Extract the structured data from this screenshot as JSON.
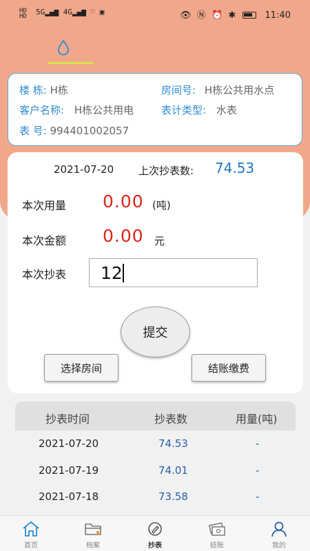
{
  "status_bar": {
    "left_top": "HD",
    "left_bottom": "HD",
    "network": "5G",
    "signal2": "4G",
    "right_icons": "👁 Ⓝ ⏰ ✱",
    "time": "11:40"
  },
  "tab_icon": "water-drop-icon",
  "info": {
    "building_label": "楼 栋:",
    "building_value": "H栋",
    "room_label": "房间号:",
    "room_value": "H栋公共用水点",
    "customer_label": "客户名称:",
    "customer_value": "H栋公共用电",
    "meter_type_label": "表计类型:",
    "meter_type_value": "水表",
    "meter_no_label": "表 号:",
    "meter_no_value": "994401002057"
  },
  "reading": {
    "date": "2021-07-20",
    "last_label": "上次抄表数:",
    "last_value": "74.53",
    "usage_label": "本次用量",
    "usage_value": "0.00",
    "usage_unit": "(吨)",
    "amount_label": "本次金额",
    "amount_value": "0.00",
    "amount_unit": "元",
    "input_label": "本次抄表",
    "input_value": "12",
    "submit_label": "提交",
    "select_room_label": "选择房间",
    "settle_label": "结账缴费"
  },
  "history": {
    "headers": [
      "抄表时间",
      "抄表数",
      "用量(吨)"
    ],
    "rows": [
      {
        "time": "2021-07-20",
        "reading": "74.53",
        "usage": "-"
      },
      {
        "time": "2021-07-19",
        "reading": "74.01",
        "usage": "-"
      },
      {
        "time": "2021-07-18",
        "reading": "73.58",
        "usage": "-"
      }
    ]
  },
  "tabbar": [
    {
      "label": "首页",
      "icon": "home-icon"
    },
    {
      "label": "档案",
      "icon": "folder-icon"
    },
    {
      "label": "抄表",
      "icon": "meter-reading-icon"
    },
    {
      "label": "结账",
      "icon": "money-icon"
    },
    {
      "label": "我的",
      "icon": "user-icon"
    }
  ],
  "colors": {
    "accent_orange": "#f1a88a",
    "label_blue": "#2f8ad0",
    "value_red": "#d9271d",
    "number_blue": "#2a5fa8"
  }
}
